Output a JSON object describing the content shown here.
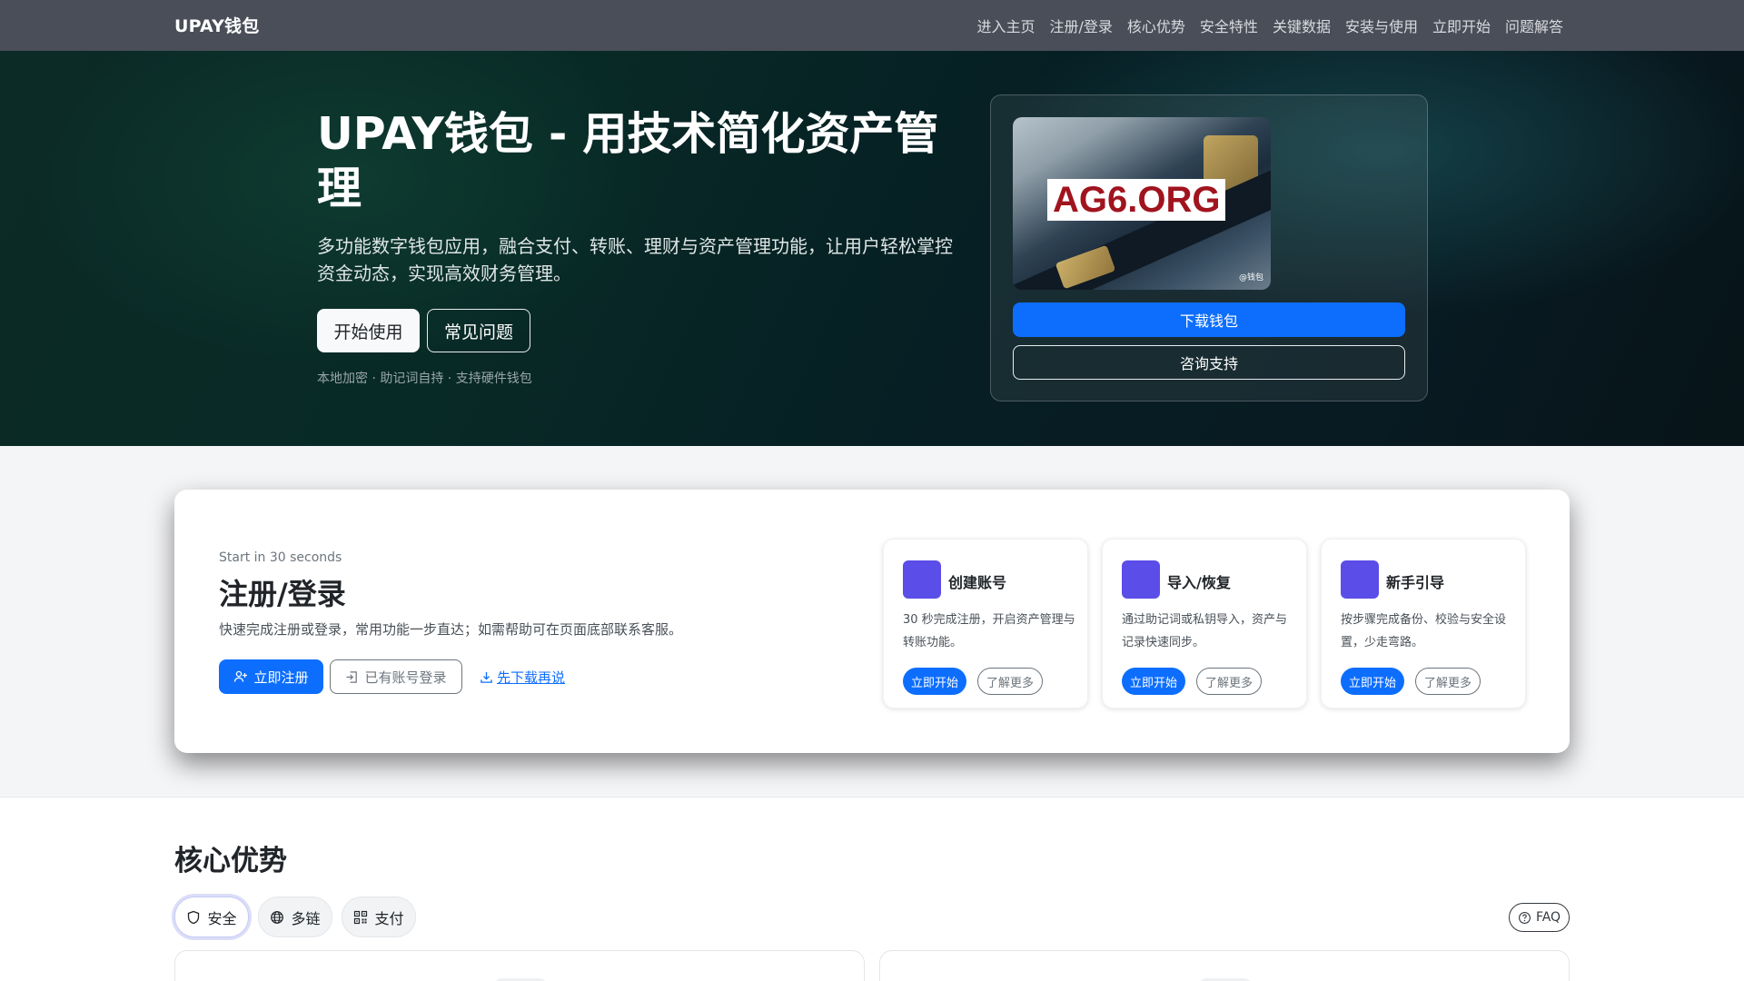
{
  "nav": {
    "brand": "UPAY钱包",
    "links": [
      "进入主页",
      "注册/登录",
      "核心优势",
      "安全特性",
      "关键数据",
      "安装与使用",
      "立即开始",
      "问题解答"
    ]
  },
  "hero": {
    "title": "UPAY钱包 - 用技术简化资产管理",
    "subtitle": "多功能数字钱包应用，融合支付、转账、理财与资产管理功能，让用户轻松掌控资金动态，实现高效财务管理。",
    "primary_label": "开始使用",
    "secondary_label": "常见问题",
    "note": "本地加密 · 助记词自持 · 支持硬件钱包",
    "card": {
      "image_text": "AG6.ORG",
      "image_watermark": "@钱包",
      "download_label": "下载钱包",
      "consult_label": "咨询支持"
    }
  },
  "register": {
    "eyebrow": "Start in 30 seconds",
    "title": "注册/登录",
    "description": "快速完成注册或登录，常用功能一步直达；如需帮助可在页面底部联系客服。",
    "register_label": "立即注册",
    "login_label": "已有账号登录",
    "download_link": "先下载再说",
    "cards": [
      {
        "title": "创建账号",
        "description": "30 秒完成注册，开启资产管理与转账功能。",
        "go_label": "立即开始",
        "more_label": "了解更多"
      },
      {
        "title": "导入/恢复",
        "description": "通过助记词或私钥导入，资产与记录快速同步。",
        "go_label": "立即开始",
        "more_label": "了解更多"
      },
      {
        "title": "新手引导",
        "description": "按步骤完成备份、校验与安全设置，少走弯路。",
        "go_label": "立即开始",
        "more_label": "了解更多"
      }
    ]
  },
  "advantages": {
    "title": "核心优势",
    "tabs": [
      {
        "label": "安全",
        "icon": "shield-icon"
      },
      {
        "label": "多链",
        "icon": "globe-icon"
      },
      {
        "label": "支付",
        "icon": "qr-code-icon"
      }
    ],
    "faq_label": "FAQ"
  },
  "colors": {
    "nav_bg": "#4a4e58",
    "primary": "#0d6efd",
    "card_icon": "#5b4de8",
    "image_text": "#a0141e"
  }
}
